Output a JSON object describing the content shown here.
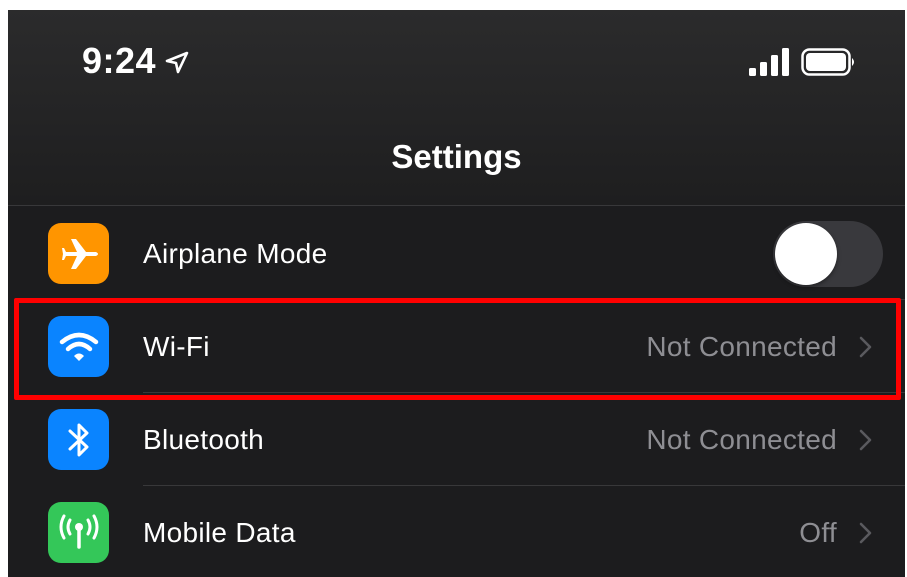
{
  "status_bar": {
    "time": "9:24",
    "location_icon": "location-arrow-icon",
    "signal_icon": "cellular-signal-icon",
    "battery_icon": "battery-icon"
  },
  "nav": {
    "title": "Settings"
  },
  "rows": [
    {
      "label": "Airplane Mode",
      "icon": "airplane-icon",
      "icon_color": "#ff9500",
      "toggle": false
    },
    {
      "label": "Wi-Fi",
      "icon": "wifi-icon",
      "icon_color": "#0a84ff",
      "value": "Not Connected"
    },
    {
      "label": "Bluetooth",
      "icon": "bluetooth-icon",
      "icon_color": "#0a84ff",
      "value": "Not Connected"
    },
    {
      "label": "Mobile Data",
      "icon": "antenna-icon",
      "icon_color": "#34c759",
      "value": "Off"
    }
  ],
  "highlight_color": "#ff0000"
}
